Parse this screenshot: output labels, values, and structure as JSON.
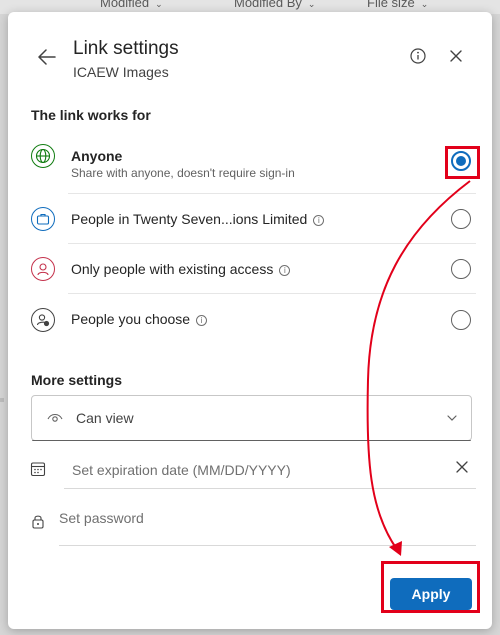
{
  "background": {
    "columns": [
      {
        "label": "Modified"
      },
      {
        "label": "Modified By"
      },
      {
        "label": "File size"
      }
    ]
  },
  "dialog": {
    "title": "Link settings",
    "subtitle": "ICAEW Images",
    "works_for_label": "The link works for",
    "options": [
      {
        "label": "Anyone",
        "description": "Share with anyone, doesn't require sign-in",
        "selected": true,
        "icon": "globe-icon",
        "icon_color": "#107c10"
      },
      {
        "label": "People in Twenty Seven...ions Limited",
        "selected": false,
        "icon": "briefcase-icon",
        "icon_color": "#0f6cbd"
      },
      {
        "label": "Only people with existing access",
        "selected": false,
        "icon": "person-icon",
        "icon_color": "#c4314b"
      },
      {
        "label": "People you choose",
        "selected": false,
        "icon": "people-settings-icon",
        "icon_color": "#424242"
      }
    ],
    "more_settings_label": "More settings",
    "permission": {
      "value": "Can view"
    },
    "expiration": {
      "placeholder": "Set expiration date (MM/DD/YYYY)"
    },
    "password": {
      "placeholder": "Set password"
    },
    "apply_label": "Apply"
  },
  "colors": {
    "accent": "#0f6cbd",
    "annotation": "#e2001a"
  }
}
